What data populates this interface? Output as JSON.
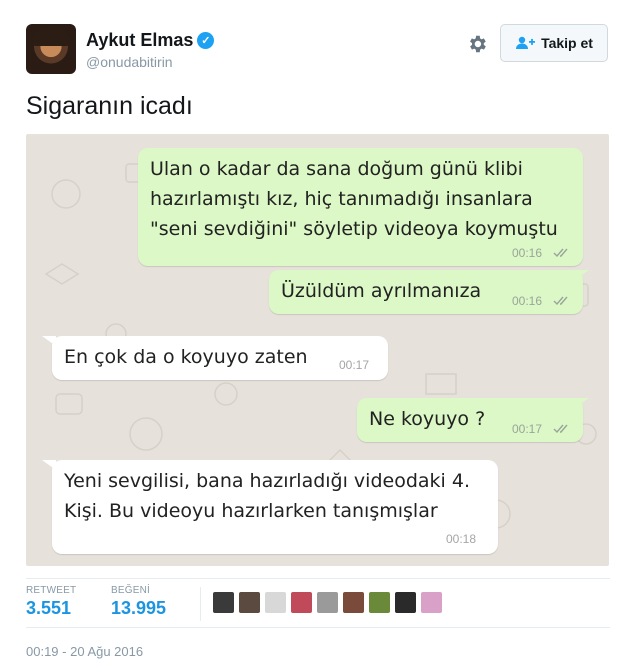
{
  "user": {
    "display_name": "Aykut Elmas",
    "handle": "@onudabitirin",
    "verified_icon": "verified-badge-icon"
  },
  "actions": {
    "follow_label": "Takip et",
    "settings_icon": "gear-icon"
  },
  "tweet": {
    "text": "Sigaranın icadı"
  },
  "chat": {
    "messages": [
      {
        "side": "out",
        "line1": "Ulan o kadar da sana doğum günü klibi",
        "line2": "hazırlamıştı kız, hiç tanımadığı insanlara",
        "line3": "\"seni sevdiğini\" söyletip videoya koymuştu",
        "time": "00:16"
      },
      {
        "side": "out",
        "line1": "Üzüldüm ayrılmanıza",
        "time": "00:16"
      },
      {
        "side": "in",
        "line1": "En çok da o koyuyo zaten",
        "time": "00:17"
      },
      {
        "side": "out",
        "line1": "Ne koyuyo ?",
        "time": "00:17"
      },
      {
        "side": "in",
        "line1": "Yeni sevgilisi, bana hazırladığı videodaki 4.",
        "line2": "Kişi. Bu videoyu hazırlarken tanışmışlar",
        "time": "00:18"
      }
    ]
  },
  "stats": {
    "retweet_label": "RETWEET",
    "retweet_count": "3.551",
    "like_label": "BEĞENİ",
    "like_count": "13.995"
  },
  "likers": [
    {
      "color": "#3a3a3a"
    },
    {
      "color": "#5a4a40"
    },
    {
      "color": "#d8d8d8"
    },
    {
      "color": "#c04a5a"
    },
    {
      "color": "#9a9a9a"
    },
    {
      "color": "#7a4a3a"
    },
    {
      "color": "#6a8a3a"
    },
    {
      "color": "#2a2a2a"
    },
    {
      "color": "#d9a0c8"
    }
  ],
  "meta": {
    "timestamp": "00:19 - 20 Ağu 2016"
  }
}
